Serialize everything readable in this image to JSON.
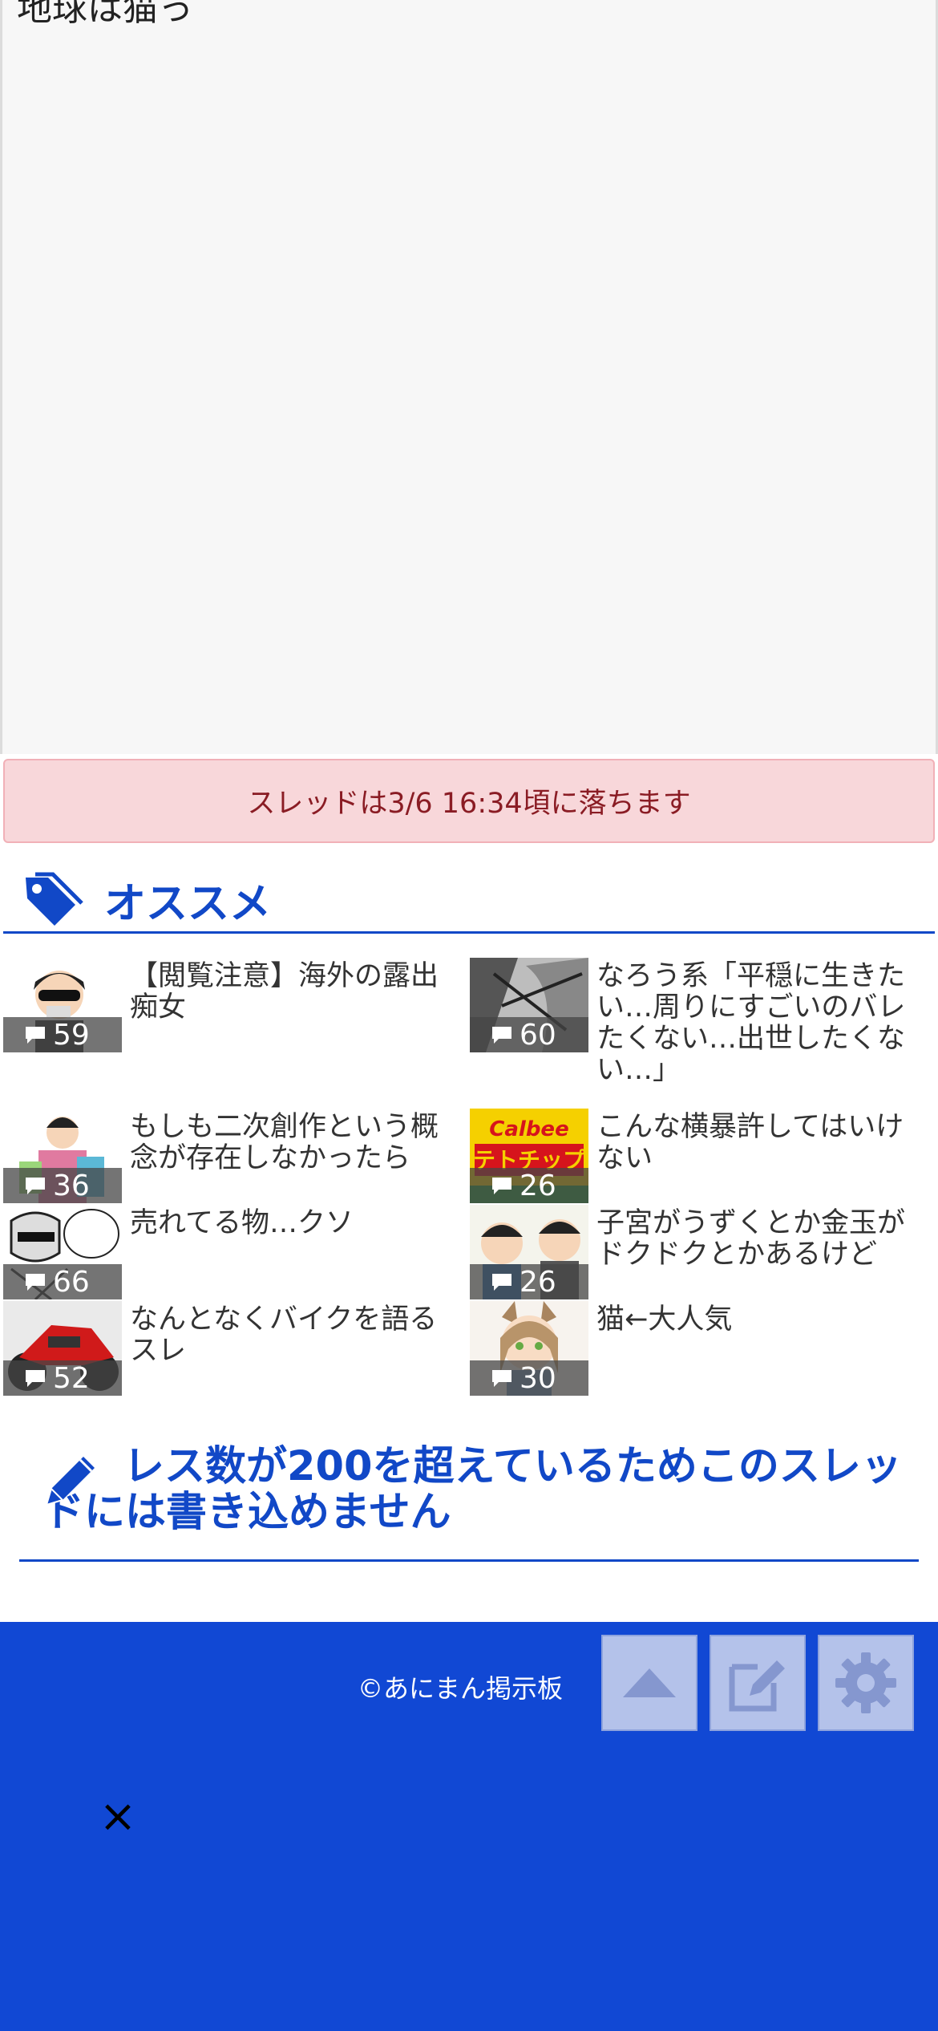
{
  "ad_area": {
    "cut_text": "地球は猫っ"
  },
  "drop_notice": "スレッドは3/6 16:34頃に落ちます",
  "recommend": {
    "title": "オススメ",
    "items": [
      {
        "title": "【閲覧注意】海外の露出痴女",
        "count": "59",
        "thumb": "cartoon-woman-sunglasses"
      },
      {
        "title": "なろう系「平穏に生きたい…周りにすごいのバレたくない…出世したくない…」",
        "count": "60",
        "thumb": "manga-panel"
      },
      {
        "title": "もしも二次創作という概念が存在しなかったら",
        "count": "36",
        "thumb": "cartoon-woman-shopping"
      },
      {
        "title": "こんな横暴許してはいけない",
        "count": "26",
        "thumb": "calbee-potato-chips"
      },
      {
        "title": "売れてる物…クソ",
        "count": "66",
        "thumb": "manga-sketch"
      },
      {
        "title": "子宮がうずくとか金玉がドクドクとかあるけど",
        "count": "26",
        "thumb": "cartoon-two-men"
      },
      {
        "title": "なんとなくバイクを語るスレ",
        "count": "52",
        "thumb": "red-motorcycle"
      },
      {
        "title": "猫←大人気",
        "count": "30",
        "thumb": "anime-catgirl"
      }
    ]
  },
  "no_write_message": "レス数が200を超えているためこのスレッドには書き込めません",
  "footer": {
    "copyright": "©あにまん掲示板",
    "buttons": [
      "scroll-top",
      "write",
      "settings"
    ],
    "close_symbol": "×"
  },
  "colors": {
    "brand_blue": "#1148d4",
    "notice_bg": "#f8d7da",
    "notice_text": "#8a1c24"
  }
}
